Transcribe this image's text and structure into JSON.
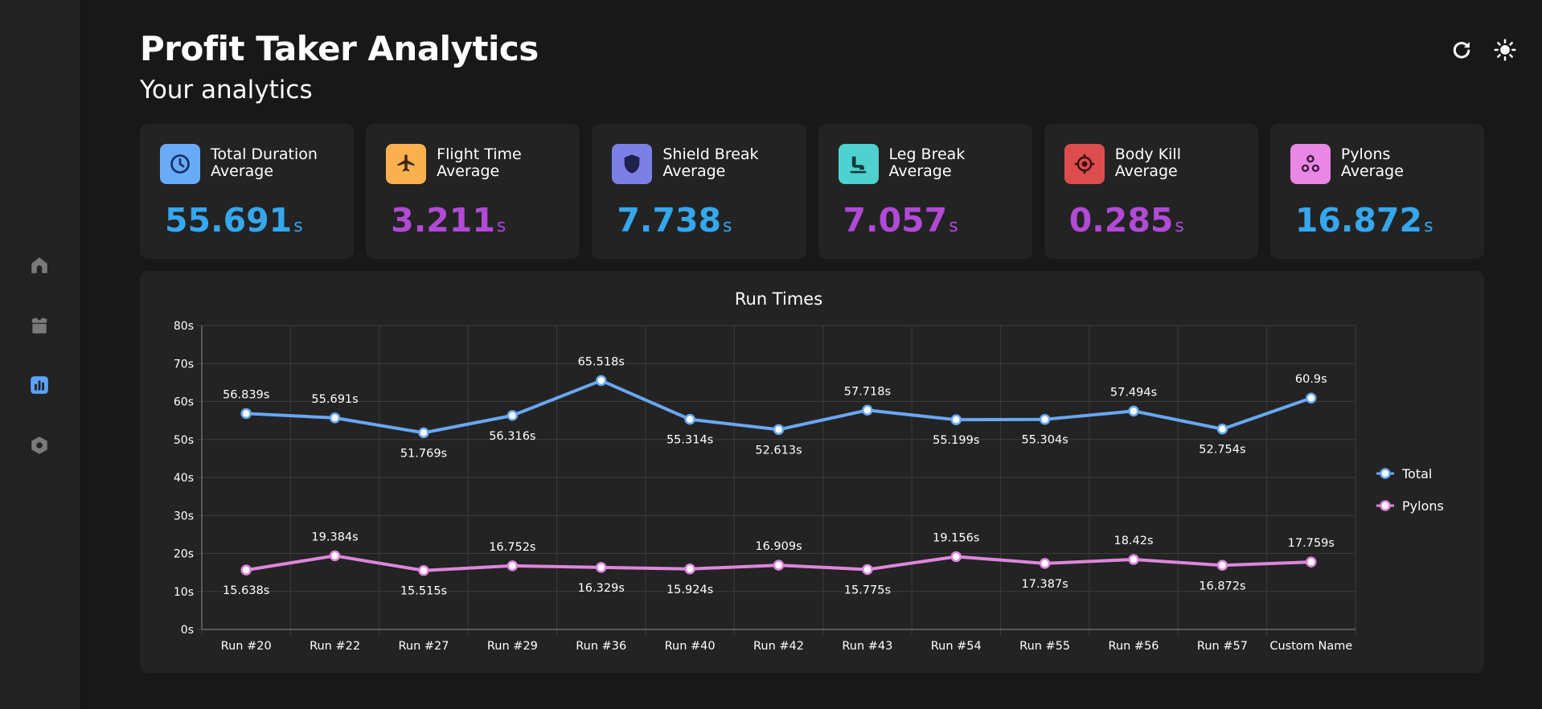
{
  "app": {
    "title": "Profit Taker Analytics",
    "subtitle": "Your analytics"
  },
  "colors": {
    "blue_value": "#35a7ef",
    "purple_value": "#b14ad7",
    "total_line": "#69a7f4",
    "pylons_line": "#de86dc",
    "active_nav": "#5ba3ff",
    "inactive_nav": "#7a7a7a"
  },
  "sidebar": {
    "items": [
      {
        "icon": "home-icon",
        "active": false
      },
      {
        "icon": "box-icon",
        "active": false
      },
      {
        "icon": "analytics-icon",
        "active": true
      },
      {
        "icon": "hexagon-icon",
        "active": false
      }
    ]
  },
  "toolbar": {
    "icons": [
      "refresh-icon",
      "sun-icon"
    ]
  },
  "cards": [
    {
      "line1": "Total Duration",
      "line2": "Average",
      "value": "55.691",
      "unit": "s",
      "icon": "clock-icon",
      "icon_bg": "#6aabf7",
      "value_color": "#35a7ef"
    },
    {
      "line1": "Flight Time",
      "line2": "Average",
      "value": "3.211",
      "unit": "s",
      "icon": "airplane-icon",
      "icon_bg": "#fbb04f",
      "value_color": "#b14ad7"
    },
    {
      "line1": "Shield Break",
      "line2": "Average",
      "value": "7.738",
      "unit": "s",
      "icon": "shield-icon",
      "icon_bg": "#7b7fe6",
      "value_color": "#35a7ef"
    },
    {
      "line1": "Leg Break",
      "line2": "Average",
      "value": "7.057",
      "unit": "s",
      "icon": "leg-icon",
      "icon_bg": "#4fd1cf",
      "value_color": "#b14ad7"
    },
    {
      "line1": "Body Kill",
      "line2": "Average",
      "value": "0.285",
      "unit": "s",
      "icon": "target-icon",
      "icon_bg": "#dc4e4e",
      "value_color": "#b14ad7"
    },
    {
      "line1": "Pylons",
      "line2": "Average",
      "value": "16.872",
      "unit": "s",
      "icon": "pylons-icon",
      "icon_bg": "#e887e4",
      "value_color": "#35a7ef"
    }
  ],
  "chart_data": {
    "type": "line",
    "title": "Run Times",
    "categories": [
      "Run #20",
      "Run #22",
      "Run #27",
      "Run #29",
      "Run #36",
      "Run #40",
      "Run #42",
      "Run #43",
      "Run #54",
      "Run #55",
      "Run #56",
      "Run #57",
      "Custom Name"
    ],
    "series": [
      {
        "name": "Total",
        "color": "#69a7f4",
        "values": [
          56.839,
          55.691,
          51.769,
          56.316,
          65.518,
          55.314,
          52.613,
          57.718,
          55.199,
          55.304,
          57.494,
          52.754,
          60.9
        ],
        "labels": [
          "56.839s",
          "55.691s",
          "51.769s",
          "56.316s",
          "65.518s",
          "55.314s",
          "52.613s",
          "57.718s",
          "55.199s",
          "55.304s",
          "57.494s",
          "52.754s",
          "60.9s"
        ]
      },
      {
        "name": "Pylons",
        "color": "#de86dc",
        "values": [
          15.638,
          19.384,
          15.515,
          16.752,
          16.329,
          15.924,
          16.909,
          15.775,
          19.156,
          17.387,
          18.42,
          16.872,
          17.759
        ],
        "labels": [
          "15.638s",
          "19.384s",
          "15.515s",
          "16.752s",
          "16.329s",
          "15.924s",
          "16.909s",
          "15.775s",
          "19.156s",
          "17.387s",
          "18.42s",
          "16.872s",
          "17.759s"
        ]
      }
    ],
    "ylim": [
      0,
      80
    ],
    "yticks": [
      "0s",
      "10s",
      "20s",
      "30s",
      "40s",
      "50s",
      "60s",
      "70s",
      "80s"
    ],
    "grid": true,
    "legend": "right"
  }
}
